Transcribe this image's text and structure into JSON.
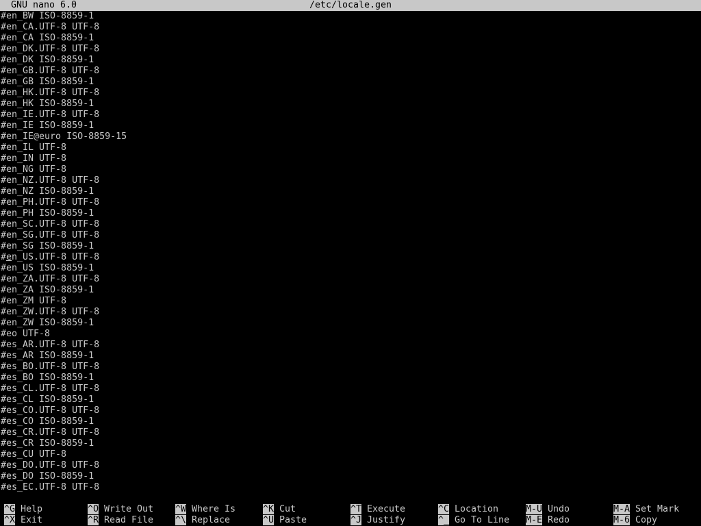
{
  "titlebar": {
    "app": "GNU nano 6.0",
    "filename": "/etc/locale.gen"
  },
  "editor": {
    "lines": [
      "#en_BW ISO-8859-1",
      "#en_CA.UTF-8 UTF-8",
      "#en_CA ISO-8859-1",
      "#en_DK.UTF-8 UTF-8",
      "#en_DK ISO-8859-1",
      "#en_GB.UTF-8 UTF-8",
      "#en_GB ISO-8859-1",
      "#en_HK.UTF-8 UTF-8",
      "#en_HK ISO-8859-1",
      "#en_IE.UTF-8 UTF-8",
      "#en_IE ISO-8859-1",
      "#en_IE@euro ISO-8859-15",
      "#en_IL UTF-8",
      "#en_IN UTF-8",
      "#en_NG UTF-8",
      "#en_NZ.UTF-8 UTF-8",
      "#en_NZ ISO-8859-1",
      "#en_PH.UTF-8 UTF-8",
      "#en_PH ISO-8859-1",
      "#en_SC.UTF-8 UTF-8",
      "#en_SG.UTF-8 UTF-8",
      "#en_SG ISO-8859-1",
      "#en_US.UTF-8 UTF-8",
      "#en_US ISO-8859-1",
      "#en_ZA.UTF-8 UTF-8",
      "#en_ZA ISO-8859-1",
      "#en_ZM UTF-8",
      "#en_ZW.UTF-8 UTF-8",
      "#en_ZW ISO-8859-1",
      "#eo UTF-8",
      "#es_AR.UTF-8 UTF-8",
      "#es_AR ISO-8859-1",
      "#es_BO.UTF-8 UTF-8",
      "#es_BO ISO-8859-1",
      "#es_CL.UTF-8 UTF-8",
      "#es_CL ISO-8859-1",
      "#es_CO.UTF-8 UTF-8",
      "#es_CO ISO-8859-1",
      "#es_CR.UTF-8 UTF-8",
      "#es_CR ISO-8859-1",
      "#es_CU UTF-8",
      "#es_DO.UTF-8 UTF-8",
      "#es_DO ISO-8859-1",
      "#es_EC.UTF-8 UTF-8"
    ],
    "cursor_line": 22
  },
  "shortcuts": {
    "row1": [
      {
        "key": "^G",
        "label": "Help"
      },
      {
        "key": "^O",
        "label": "Write Out"
      },
      {
        "key": "^W",
        "label": "Where Is"
      },
      {
        "key": "^K",
        "label": "Cut"
      },
      {
        "key": "^T",
        "label": "Execute"
      },
      {
        "key": "^C",
        "label": "Location"
      },
      {
        "key": "M-U",
        "label": "Undo"
      },
      {
        "key": "M-A",
        "label": "Set Mark"
      }
    ],
    "row2": [
      {
        "key": "^X",
        "label": "Exit"
      },
      {
        "key": "^R",
        "label": "Read File"
      },
      {
        "key": "^\\",
        "label": "Replace"
      },
      {
        "key": "^U",
        "label": "Paste"
      },
      {
        "key": "^J",
        "label": "Justify"
      },
      {
        "key": "^_",
        "label": "Go To Line"
      },
      {
        "key": "M-E",
        "label": "Redo"
      },
      {
        "key": "M-6",
        "label": "Copy"
      }
    ]
  },
  "colors": {
    "background": "#000000",
    "text": "#c8c8c8",
    "bar": "#c8c8c8"
  }
}
